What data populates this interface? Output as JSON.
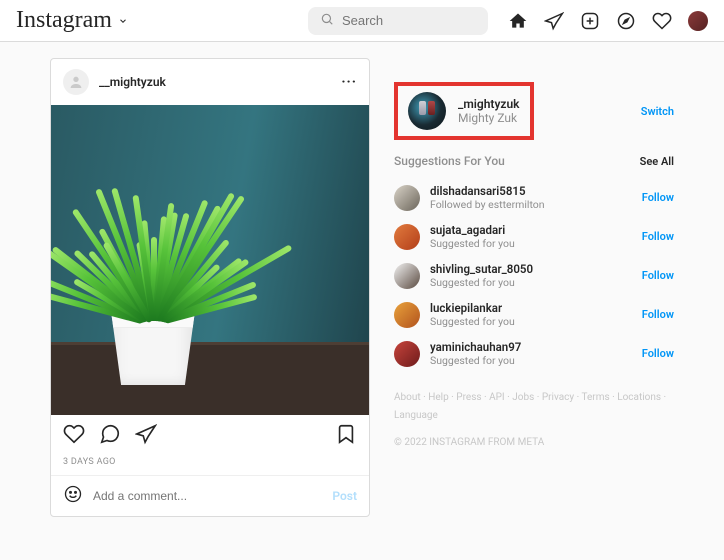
{
  "brand": "Instagram",
  "search": {
    "placeholder": "Search"
  },
  "post": {
    "username": "__mightyzuk",
    "timestamp": "3 DAYS AGO",
    "comment_placeholder": "Add a comment...",
    "post_label": "Post"
  },
  "sidebar": {
    "current": {
      "username": "_mightyzuk",
      "display_name": "Mighty Zuk"
    },
    "switch_label": "Switch",
    "suggestions_heading": "Suggestions For You",
    "see_all_label": "See All",
    "follow_label": "Follow",
    "suggestions": [
      {
        "username": "dilshadansari5815",
        "subtext": "Followed by esttermilton",
        "av": "linear-gradient(135deg,#d9d3c8,#6b655a)"
      },
      {
        "username": "sujata_agadari",
        "subtext": "Suggested for you",
        "av": "linear-gradient(135deg,#e27b3e,#b23e19)"
      },
      {
        "username": "shivling_sutar_8050",
        "subtext": "Suggested for you",
        "av": "linear-gradient(135deg,#f2f2f2,#5a4a40)"
      },
      {
        "username": "luckiepilankar",
        "subtext": "Suggested for you",
        "av": "linear-gradient(135deg,#e9a23b,#b1521d)"
      },
      {
        "username": "yaminichauhan97",
        "subtext": "Suggested for you",
        "av": "linear-gradient(135deg,#c7443c,#6e1b1b)"
      }
    ]
  },
  "footer": {
    "links": [
      "About",
      "Help",
      "Press",
      "API",
      "Jobs",
      "Privacy",
      "Terms",
      "Locations",
      "Language"
    ],
    "copyright": "© 2022 INSTAGRAM FROM META"
  }
}
